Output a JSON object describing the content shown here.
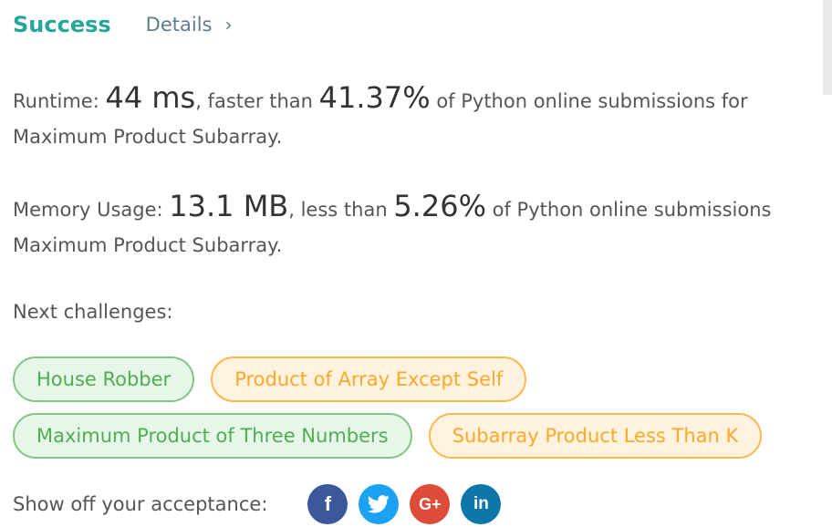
{
  "header": {
    "status": "Success",
    "details_label": "Details",
    "chevron": "›"
  },
  "runtime": {
    "label": "Runtime: ",
    "value": "44 ms",
    "comparison": ", faster than ",
    "percent": "41.37%",
    "suffix": " of Python online submissions for",
    "problem": "Maximum Product Subarray."
  },
  "memory": {
    "label": "Memory Usage: ",
    "value": "13.1 MB",
    "comparison": ", less than ",
    "percent": "5.26%",
    "suffix": " of Python online submissions",
    "problem": "Maximum Product Subarray."
  },
  "next": {
    "label": "Next challenges:",
    "challenges": [
      {
        "title": "House Robber",
        "difficulty": "easy"
      },
      {
        "title": "Product of Array Except Self",
        "difficulty": "medium"
      },
      {
        "title": "Maximum Product of Three Numbers",
        "difficulty": "easy"
      },
      {
        "title": "Subarray Product Less Than K",
        "difficulty": "medium"
      }
    ]
  },
  "share": {
    "label": "Show off your acceptance:",
    "networks": [
      {
        "name": "facebook-icon",
        "glyph": "f",
        "color": "#3b5998"
      },
      {
        "name": "twitter-icon",
        "glyph": "t",
        "color": "#1da1f2"
      },
      {
        "name": "google-plus-icon",
        "glyph": "G+",
        "color": "#dd4b39"
      },
      {
        "name": "linkedin-icon",
        "glyph": "in",
        "color": "#0e76a8"
      }
    ]
  },
  "colors": {
    "success": "#26a69a",
    "easy": "#4caf50",
    "medium": "#ffa726"
  }
}
